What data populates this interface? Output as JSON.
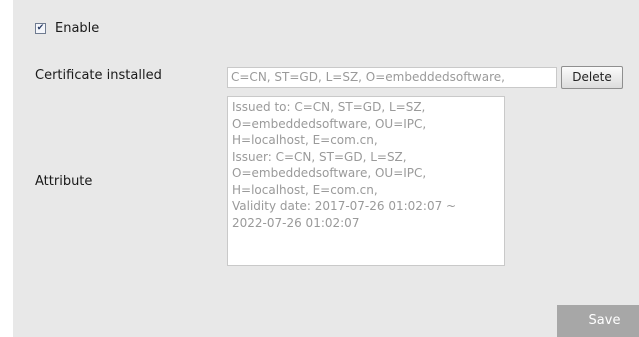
{
  "enable": {
    "checked_glyph": "✔",
    "label": "Enable"
  },
  "certificate": {
    "label": "Certificate installed",
    "value": "C=CN, ST=GD, L=SZ, O=embeddedsoftware,",
    "delete_label": "Delete"
  },
  "attribute": {
    "label": "Attribute",
    "lines": [
      "Issued to: C=CN, ST=GD, L=SZ,",
      "O=embeddedsoftware, OU=IPC,",
      "H=localhost, E=com.cn,",
      "Issuer: C=CN, ST=GD, L=SZ,",
      "O=embeddedsoftware, OU=IPC,",
      "H=localhost, E=com.cn,",
      "Validity date: 2017-07-26 01:02:07 ~",
      "2022-07-26 01:02:07"
    ]
  },
  "footer": {
    "save_label": "Save"
  },
  "colors": {
    "panel_bg": "#e8e8e8",
    "save_bg": "#a7a7a7",
    "input_text": "#9a9a9a"
  }
}
